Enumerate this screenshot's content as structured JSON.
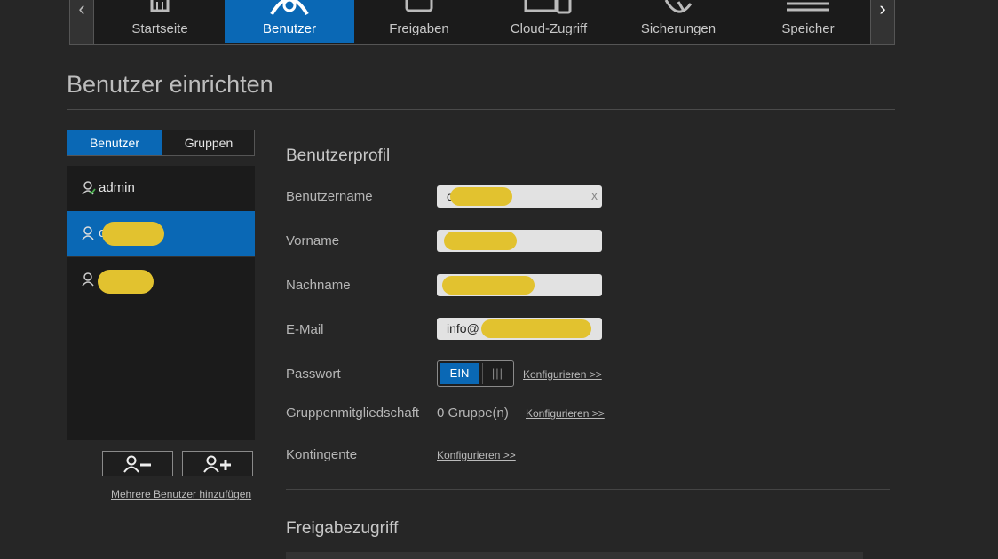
{
  "nav": {
    "tabs": [
      {
        "label": "Startseite",
        "icon": "home-icon"
      },
      {
        "label": "Benutzer",
        "icon": "user-icon",
        "active": true
      },
      {
        "label": "Freigaben",
        "icon": "folder-icon"
      },
      {
        "label": "Cloud-Zugriff",
        "icon": "devices-icon"
      },
      {
        "label": "Sicherungen",
        "icon": "backup-icon"
      },
      {
        "label": "Speicher",
        "icon": "storage-icon"
      }
    ],
    "prev_glyph": "‹",
    "next_glyph": "›"
  },
  "page": {
    "title": "Benutzer einrichten"
  },
  "segment": {
    "users": "Benutzer",
    "groups": "Gruppen"
  },
  "users": [
    {
      "name": "admin",
      "icon": "admin-user-icon"
    },
    {
      "name": "c",
      "icon": "user-icon",
      "active": true,
      "redacted": true
    },
    {
      "name": "",
      "icon": "user-icon",
      "redacted": true
    }
  ],
  "actions": {
    "remove_user_icon": "remove-user-icon",
    "add_user_icon": "add-user-icon",
    "multi_link": "Mehrere Benutzer hinzufügen"
  },
  "profile": {
    "title": "Benutzerprofil",
    "username": {
      "label": "Benutzername",
      "value": "c",
      "clear": "x"
    },
    "firstname": {
      "label": "Vorname",
      "value": ""
    },
    "lastname": {
      "label": "Nachname",
      "value": ""
    },
    "email": {
      "label": "E-Mail",
      "value": "info@"
    },
    "password": {
      "label": "Passwort",
      "toggle_on": "EIN",
      "toggle_grip": "|||",
      "link": "Konfigurieren >>"
    },
    "groups": {
      "label": "Gruppenmitgliedschaft",
      "value": "0 Gruppe(n)",
      "link": "Konfigurieren >>"
    },
    "quota": {
      "label": "Kontingente",
      "link": "Konfigurieren >>"
    }
  },
  "share": {
    "title": "Freigabezugriff"
  },
  "colors": {
    "accent": "#0a68b5",
    "redaction": "#e2c22f",
    "background": "#262626"
  }
}
